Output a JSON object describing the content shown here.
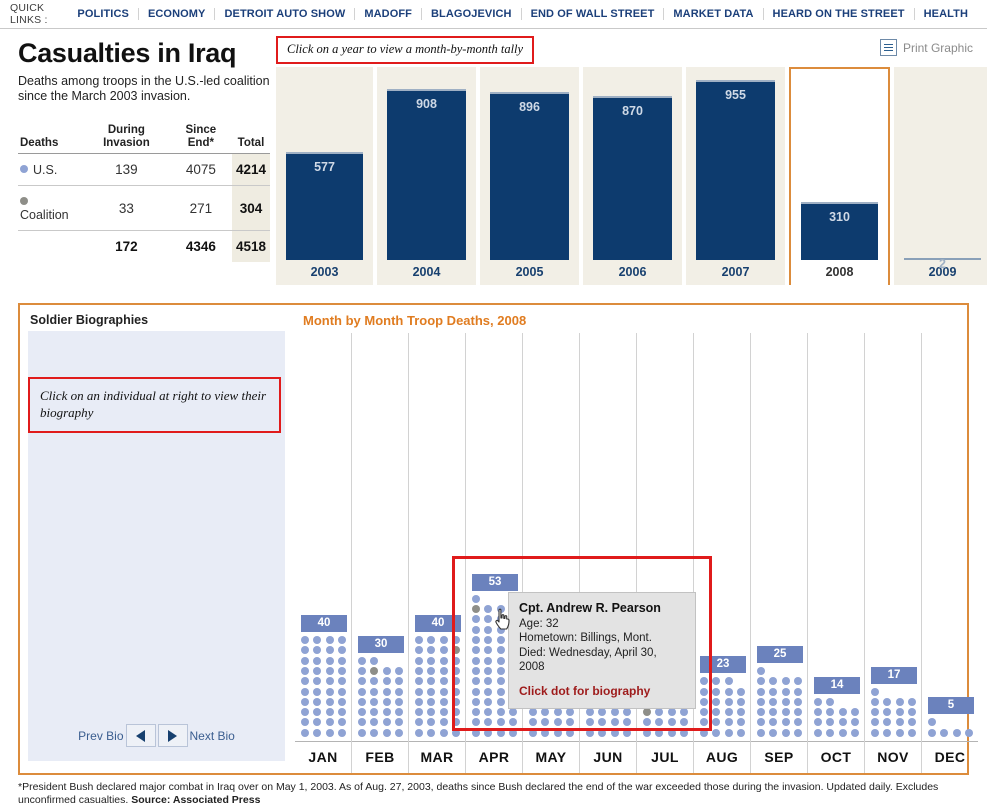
{
  "quicklinks": {
    "label": "QUICK LINKS :",
    "items": [
      "POLITICS",
      "ECONOMY",
      "DETROIT AUTO SHOW",
      "MADOFF",
      "BLAGOJEVICH",
      "END OF WALL STREET",
      "MARKET DATA",
      "HEARD ON THE STREET",
      "HEALTH"
    ]
  },
  "header": {
    "title": "Casualties in Iraq",
    "subtitle": "Deaths among troops in the U.S.-led coalition since the March 2003 invasion.",
    "year_hint": "Click on a year to view a month-by-month tally",
    "print_label": "Print Graphic",
    "print_icon": "printer-icon"
  },
  "table": {
    "headers": [
      "Deaths",
      "During Invasion",
      "Since End*",
      "Total"
    ],
    "rows": [
      {
        "label": "U.S.",
        "dot_color": "#8fa3d4",
        "during": "139",
        "since": "4075",
        "total": "4214"
      },
      {
        "label": "Coalition",
        "dot_color": "#8e8e88",
        "during": "33",
        "since": "271",
        "total": "304"
      }
    ],
    "sum": {
      "during": "172",
      "since": "4346",
      "total": "4518"
    }
  },
  "bio": {
    "heading": "Soldier Biographies",
    "hint": "Click on an individual at right to view their biography",
    "prev_label": "Prev Bio",
    "next_label": "Next Bio",
    "prev_icon": "left-arrow-icon",
    "next_icon": "right-arrow-icon"
  },
  "month_section": {
    "title": "Month by Month Troop Deaths, 2008"
  },
  "tooltip": {
    "name": "Cpt. Andrew R. Pearson",
    "age": "Age: 32",
    "hometown": "Hometown: Billings, Mont.",
    "died": "Died: Wednesday, April 30, 2008",
    "cta": "Click dot for biography",
    "cursor_icon": "pointing-hand-cursor"
  },
  "colors": {
    "bar": "#0d3b6e",
    "bar_bg": "#f2efe6",
    "accent_orange": "#dc8c3c",
    "highlight_red": "#e01b1b",
    "dot_us": "#8fa3d4",
    "dot_coalition": "#8e8e88",
    "count_badge": "#6b82bd",
    "bio_panel": "#e8ecf6"
  },
  "footer": {
    "note": "*President Bush declared major combat in Iraq over on May 1, 2003. As of Aug. 27, 2003, deaths since Bush declared the end of the war exceeded those during the invasion. Updated daily. Excludes unconfirmed casualties.",
    "source": "Source: Associated Press"
  },
  "chart_data": [
    {
      "type": "bar",
      "title": "Casualties in Iraq — deaths by year",
      "xlabel": "",
      "ylabel": "Deaths",
      "ylim": [
        0,
        1000
      ],
      "categories": [
        "2003",
        "2004",
        "2005",
        "2006",
        "2007",
        "2008",
        "2009"
      ],
      "values": [
        577,
        908,
        896,
        870,
        955,
        310,
        2
      ],
      "selected": "2008",
      "grid": false,
      "legend": "none"
    },
    {
      "type": "bar",
      "title": "Month by Month Troop Deaths, 2008",
      "xlabel": "",
      "ylabel": "Deaths",
      "ylim": [
        0,
        60
      ],
      "categories": [
        "JAN",
        "FEB",
        "MAR",
        "APR",
        "MAY",
        "JUN",
        "JUL",
        "AUG",
        "SEP",
        "OCT",
        "NOV",
        "DEC"
      ],
      "values": [
        40,
        30,
        40,
        53,
        21,
        30,
        13,
        23,
        25,
        14,
        17,
        5
      ],
      "series": [
        {
          "name": "U.S.",
          "values": [
            40,
            29,
            39,
            52,
            20,
            29,
            12,
            23,
            25,
            14,
            17,
            5
          ]
        },
        {
          "name": "Coalition",
          "values": [
            0,
            1,
            1,
            1,
            1,
            1,
            1,
            0,
            0,
            0,
            0,
            0
          ]
        }
      ],
      "grid": false,
      "legend": "none",
      "note": "Each dot is one death; rows of four. Gray dots are coalition (non-U.S.) deaths."
    }
  ]
}
